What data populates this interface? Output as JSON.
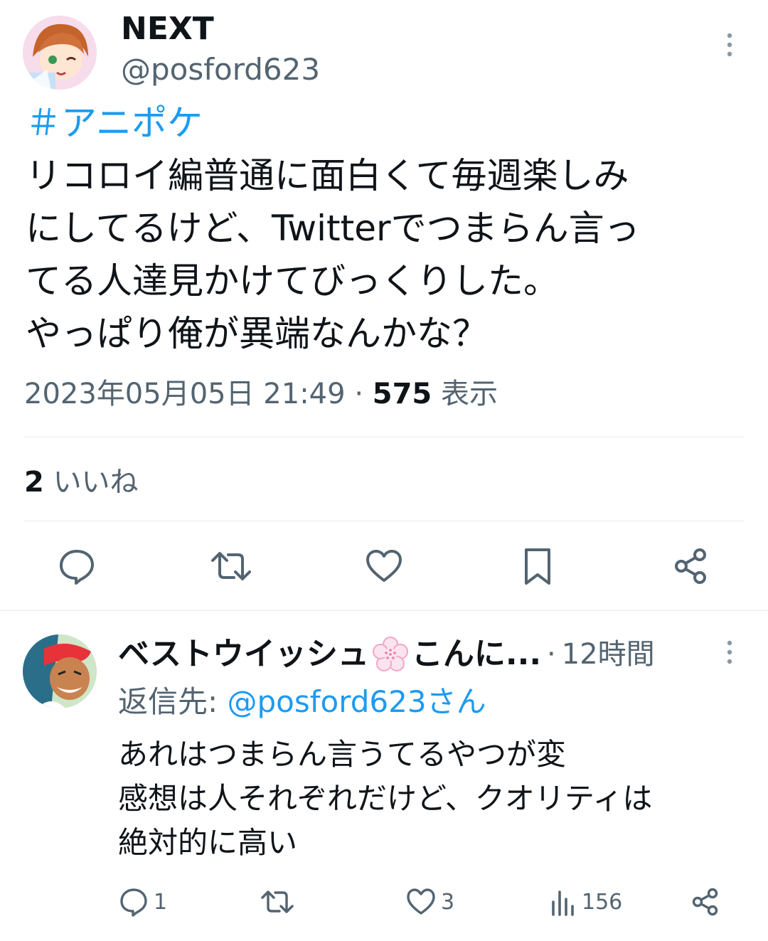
{
  "post": {
    "author_name": "NEXT",
    "author_handle": "@posford623",
    "hashtag": "＃アニポケ",
    "text_lines": [
      "リコロイ編普通に面白くて毎週楽しみ",
      "にしてるけど、Twitterでつまらん言っ",
      "てる人達見かけてびっくりした。",
      "やっぱり俺が異端なんかな？"
    ],
    "timestamp": "2023年05月05日 21:49",
    "separator": "·",
    "views_count": "575",
    "views_label": "表示",
    "likes_count": "2",
    "likes_label": "いいね",
    "actions": [
      "reply-icon",
      "retweet-icon",
      "like-icon",
      "bookmark-icon",
      "share-icon"
    ]
  },
  "reply": {
    "author_name": "ベストウイッシュ",
    "author_name_tail": "こんに...",
    "separator": "·",
    "time": "12時間",
    "reply_to_prefix": "返信先: ",
    "reply_to_handle": "@posford623さん",
    "text_lines": [
      "あれはつまらん言うてるやつが変",
      "感想は人それぞれだけど、クオリティは",
      "絶対的に高い"
    ],
    "replies": "1",
    "likes": "3",
    "views": "156"
  },
  "colors": {
    "link": "#1d9bf0",
    "muted": "#536471",
    "text": "#0f1419",
    "divider": "#e6e9ec"
  }
}
